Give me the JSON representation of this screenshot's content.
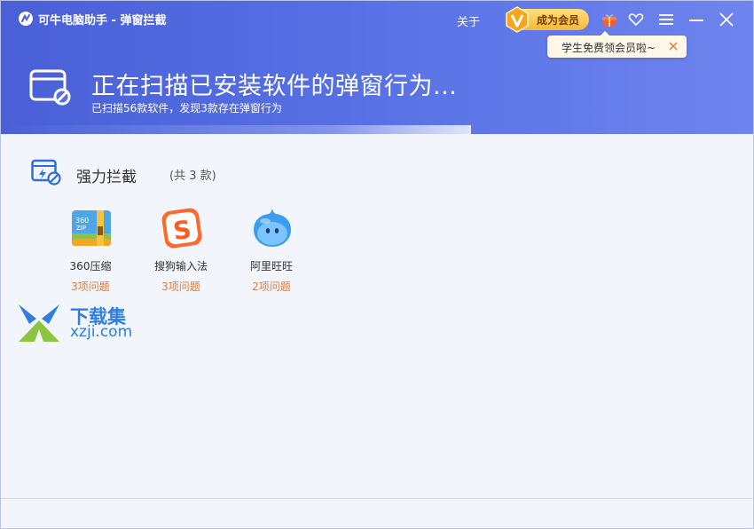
{
  "window": {
    "title": "可牛电脑助手 - 弹窗拦截",
    "about_label": "关于",
    "vip_label": "成为会员",
    "tooltip_text": "学生免费领会员啦~"
  },
  "scan": {
    "title": "正在扫描已安装软件的弹窗行为...",
    "subtitle": "已扫描56款软件，发现3款存在弹窗行为"
  },
  "section": {
    "title": "强力拦截",
    "count": "(共 3 款)"
  },
  "apps": [
    {
      "name": "360压缩",
      "issues": "3项问题",
      "icon": "360zip-icon"
    },
    {
      "name": "搜狗输入法",
      "issues": "3项问题",
      "icon": "sogou-icon"
    },
    {
      "name": "阿里旺旺",
      "issues": "2项问题",
      "icon": "aliwangwang-icon"
    }
  ],
  "watermark": {
    "brand": "下载集",
    "domain": "xzji.com"
  },
  "colors": {
    "header_start": "#4a5fd6",
    "header_end": "#6e84ee",
    "issue_text": "#e07b39",
    "vip_gold": "#f5b93a"
  }
}
